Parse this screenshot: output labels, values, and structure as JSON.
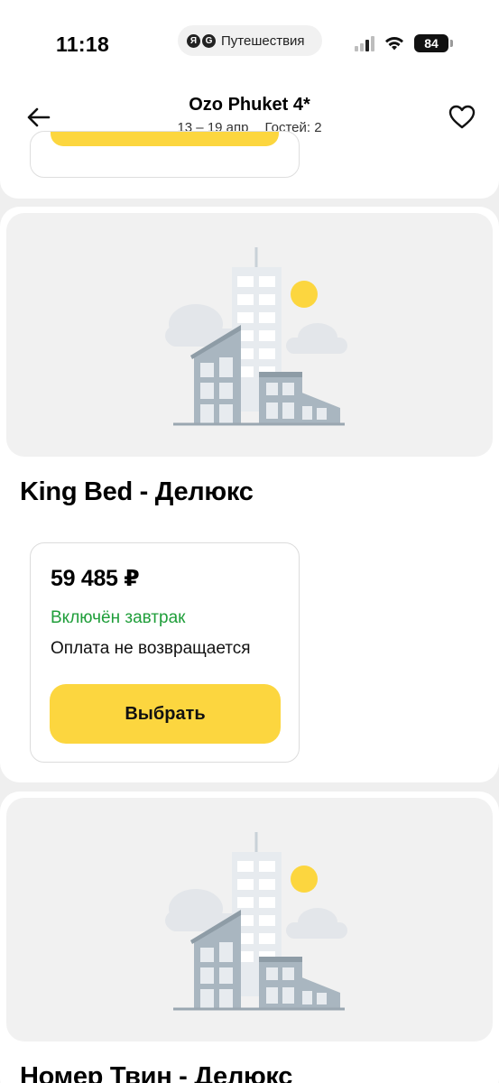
{
  "status_bar": {
    "time": "11:18",
    "app_logo_letters": [
      "Я",
      "G"
    ],
    "app_name": "Путешествия",
    "battery": "84"
  },
  "header": {
    "hotel_name": "Ozo Phuket 4*",
    "dates": "13 – 19 апр",
    "guests": "Гостей: 2",
    "back_icon": "arrow-left-icon",
    "favorite_icon": "heart-outline-icon"
  },
  "rooms": [
    {
      "name": "King Bed - Делюкс",
      "offer": {
        "price": "59 485 ₽",
        "meal": "Включён завтрак",
        "refund_policy": "Оплата не возвращается",
        "button_label": "Выбрать"
      }
    },
    {
      "name": "Номер Твин - Делюкс"
    }
  ],
  "colors": {
    "accent_yellow": "#fcd63f",
    "breakfast_green": "#1f9e3a",
    "page_background": "#efefef"
  }
}
